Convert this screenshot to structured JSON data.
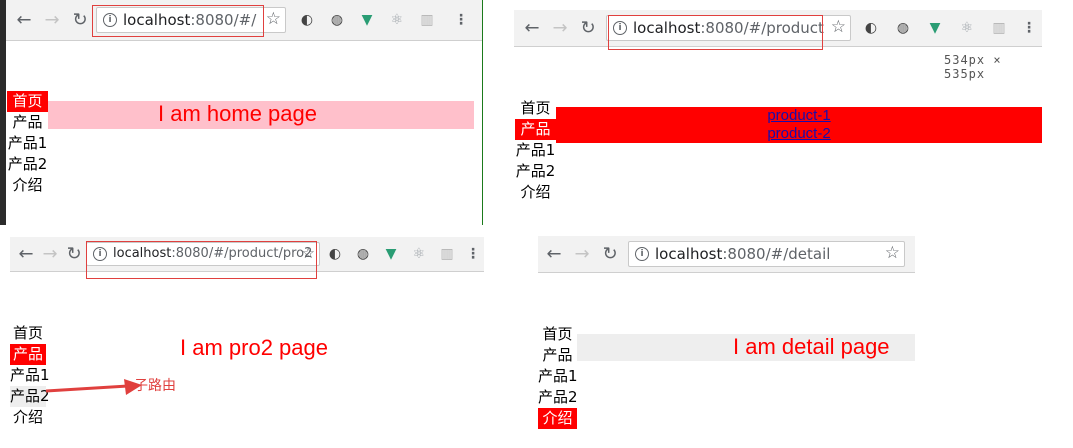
{
  "icons": {
    "back": "←",
    "forward": "→",
    "reload": "↻",
    "info": "i",
    "star": "☆",
    "ext_a": "◐",
    "ext_b": "◍",
    "ext_vue": "▼",
    "ext_react": "⚛",
    "ext_layout": "▥",
    "menu": "⋮",
    "arrow": "arrow-right"
  },
  "colors": {
    "active": "#ff0000",
    "highlight_pink": "#ffc0cb",
    "gray_band": "#eeeeee",
    "link": "#1a0dab"
  },
  "panels": {
    "home": {
      "url_host": "localhost",
      "url_rest": ":8080/#/",
      "menu": [
        "首页",
        "产品",
        "产品1",
        "产品2",
        "介绍"
      ],
      "active_index": 0,
      "content": "I am home page"
    },
    "product": {
      "url_host": "localhost",
      "url_rest": ":8080/#/product",
      "menu": [
        "首页",
        "产品",
        "产品1",
        "产品2",
        "介绍"
      ],
      "active_index": 1,
      "links": [
        "product-1",
        "product-2"
      ],
      "size_label": "534px × 535px"
    },
    "pro2": {
      "url_host": "localhost",
      "url_rest": ":8080/#/product/pro2",
      "menu": [
        "首页",
        "产品",
        "产品1",
        "产品2",
        "介绍"
      ],
      "active_index": 1,
      "content": "I am pro2 page",
      "annotation": "子路由"
    },
    "detail": {
      "url_host": "localhost",
      "url_rest": ":8080/#/detail",
      "menu": [
        "首页",
        "产品",
        "产品1",
        "产品2",
        "介绍"
      ],
      "active_index": 4,
      "content": "I am detail page"
    }
  }
}
